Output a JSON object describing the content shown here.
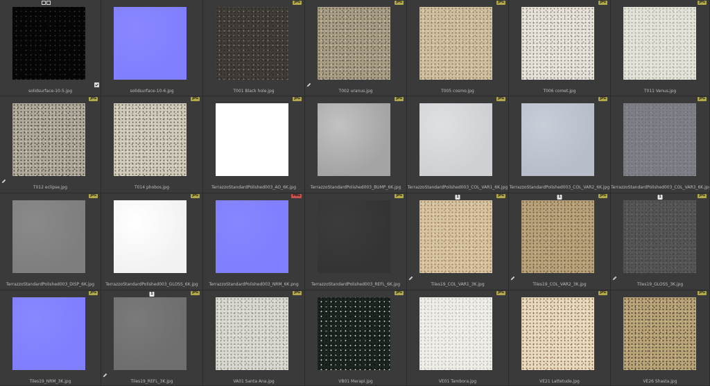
{
  "items": [
    {
      "label": "solidsurface-10-5.jpg",
      "badge": "",
      "c1": "#050505",
      "c2": "#3a3a3a",
      "c3": "#0a0a0a",
      "noise": true,
      "selected": true,
      "pencil": false,
      "check": true
    },
    {
      "label": "solidsurface-10-6.jpg",
      "badge": "",
      "c1": "#7f7fff",
      "c2": "#8a86ff",
      "c3": "#7b7bf6",
      "noise": false,
      "pencil": false,
      "check": false
    },
    {
      "label": "T001 Black hole.jpg",
      "badge": "JPG",
      "c1": "#403c38",
      "c2": "#8c8378",
      "c3": "#2a2723",
      "noise": true,
      "pencil": false
    },
    {
      "label": "T002 uranus.jpg",
      "badge": "JPG",
      "c1": "#a79e85",
      "c2": "#d4cbb4",
      "c3": "#5b5446",
      "noise": true,
      "pencil": true
    },
    {
      "label": "T005 cosmo.jpg",
      "badge": "JPG",
      "c1": "#cfbea0",
      "c2": "#eee1c8",
      "c3": "#8f7a5b",
      "noise": true,
      "pencil": false
    },
    {
      "label": "T006 comet.jpg",
      "badge": "JPG",
      "c1": "#e5e1d9",
      "c2": "#ffffff",
      "c3": "#8a8378",
      "noise": true,
      "pencil": false
    },
    {
      "label": "T011 Venus.jpg",
      "badge": "JPG",
      "c1": "#e2e2d8",
      "c2": "#f4f4ec",
      "c3": "#a8a898",
      "noise": true,
      "pencil": false
    },
    {
      "label": "T012 eclipse.jpg",
      "badge": "JPG",
      "c1": "#b0aa9c",
      "c2": "#ddd6c6",
      "c3": "#4c473e",
      "noise": true,
      "pencil": true
    },
    {
      "label": "T014 phobos.jpg",
      "badge": "JPG",
      "c1": "#d0cabb",
      "c2": "#ede8dc",
      "c3": "#6a6456",
      "noise": true,
      "pencil": false
    },
    {
      "label": "TerrazzoStandardPolished003_AO_6K.jpg",
      "badge": "JPG",
      "c1": "#ffffff",
      "c2": "#ffffff",
      "c3": "#f6f6f6",
      "noise": false,
      "pencil": false
    },
    {
      "label": "TerrazzoStandardPolished003_BUMP_6K.jpg",
      "badge": "JPG",
      "c1": "#a4a4a4",
      "c2": "#c2c2c2",
      "c3": "#8a8a8a",
      "noise": false,
      "pencil": false
    },
    {
      "label": "TerrazzoStandardPolished003_COL_VAR1_6K.jpg",
      "badge": "JPG",
      "c1": "#cfd0d3",
      "c2": "#dfe0e3",
      "c3": "#b9babd",
      "noise": false,
      "pencil": false
    },
    {
      "label": "TerrazzoStandardPolished003_COL_VAR2_6K.jpg",
      "badge": "JPG",
      "c1": "#b8bec9",
      "c2": "#c8ced8",
      "c3": "#a2a8b2",
      "noise": false,
      "pencil": false
    },
    {
      "label": "TerrazzoStandardPolished003_COL_VAR3_6K.jpg",
      "badge": "JPG",
      "c1": "#7d7f86",
      "c2": "#92949b",
      "c3": "#6a6c72",
      "noise": true,
      "pencil": false
    },
    {
      "label": "TerrazzoStandardPolished003_DISP_6K.jpg",
      "badge": "JPG",
      "c1": "#7e7e7e",
      "c2": "#8a8a8a",
      "c3": "#737373",
      "noise": false,
      "pencil": false
    },
    {
      "label": "TerrazzoStandardPolished003_GLOSS_6K.jpg",
      "badge": "JPG",
      "c1": "#f2f2f2",
      "c2": "#ffffff",
      "c3": "#e4e4e4",
      "noise": false,
      "pencil": false
    },
    {
      "label": "TerrazzoStandardPolished003_NRM_6K.png",
      "badge": "PNG",
      "c1": "#7f7fff",
      "c2": "#8686ff",
      "c3": "#7878f6",
      "noise": false,
      "pencil": false
    },
    {
      "label": "TerrazzoStandardPolished003_REFL_6K.jpg",
      "badge": "JPG",
      "c1": "#343434",
      "c2": "#3c3c3c",
      "c3": "#2e2e2e",
      "noise": false,
      "pencil": false
    },
    {
      "label": "Tiles19_COL_VAR1_3K.jpg",
      "badge": "JPG",
      "c1": "#d7c3a0",
      "c2": "#ecdcc0",
      "c3": "#9a8260",
      "noise": true,
      "pencil": true,
      "count": "1"
    },
    {
      "label": "Tiles19_COL_VAR2_3K.jpg",
      "badge": "JPG",
      "c1": "#b8a27a",
      "c2": "#cbb792",
      "c3": "#6e5c40",
      "noise": true,
      "pencil": true,
      "count": "1"
    },
    {
      "label": "Tiles19_GLOSS_3K.jpg",
      "badge": "JPG",
      "c1": "#555555",
      "c2": "#6d6d6d",
      "c3": "#3f3f3f",
      "noise": true,
      "pencil": true,
      "count": "1"
    },
    {
      "label": "Tiles19_NRM_3K.jpg",
      "badge": "JPG",
      "c1": "#7f7fff",
      "c2": "#8888ff",
      "c3": "#7676f4",
      "noise": false,
      "pencil": false
    },
    {
      "label": "Tiles19_REFL_3K.jpg",
      "badge": "JPG",
      "c1": "#6e6e6e",
      "c2": "#7a7a7a",
      "c3": "#626262",
      "noise": false,
      "pencil": true,
      "count": "1"
    },
    {
      "label": "VA01 Santa Ana.jpg",
      "badge": "JPG",
      "c1": "#d8d8d0",
      "c2": "#efefe7",
      "c3": "#8c8c84",
      "noise": true,
      "pencil": false
    },
    {
      "label": "VB01 Merapi.jpg",
      "badge": "JPG",
      "c1": "#1c2520",
      "c2": "#e6ede6",
      "c3": "#0b120e",
      "noise": true,
      "pencil": false
    },
    {
      "label": "VE01 Tambora.jpg",
      "badge": "JPG",
      "c1": "#eeede7",
      "c2": "#fbfbf7",
      "c3": "#bdbcb5",
      "noise": true,
      "pencil": false
    },
    {
      "label": "VE21 Lattetude.jpg",
      "badge": "JPG",
      "c1": "#e8d9be",
      "c2": "#fbf1df",
      "c3": "#8a7052",
      "noise": true,
      "pencil": false
    },
    {
      "label": "VE26 Shasta.jpg",
      "badge": "JPG",
      "c1": "#b9a478",
      "c2": "#d8c59b",
      "c3": "#4e4030",
      "noise": true,
      "pencil": false
    }
  ]
}
